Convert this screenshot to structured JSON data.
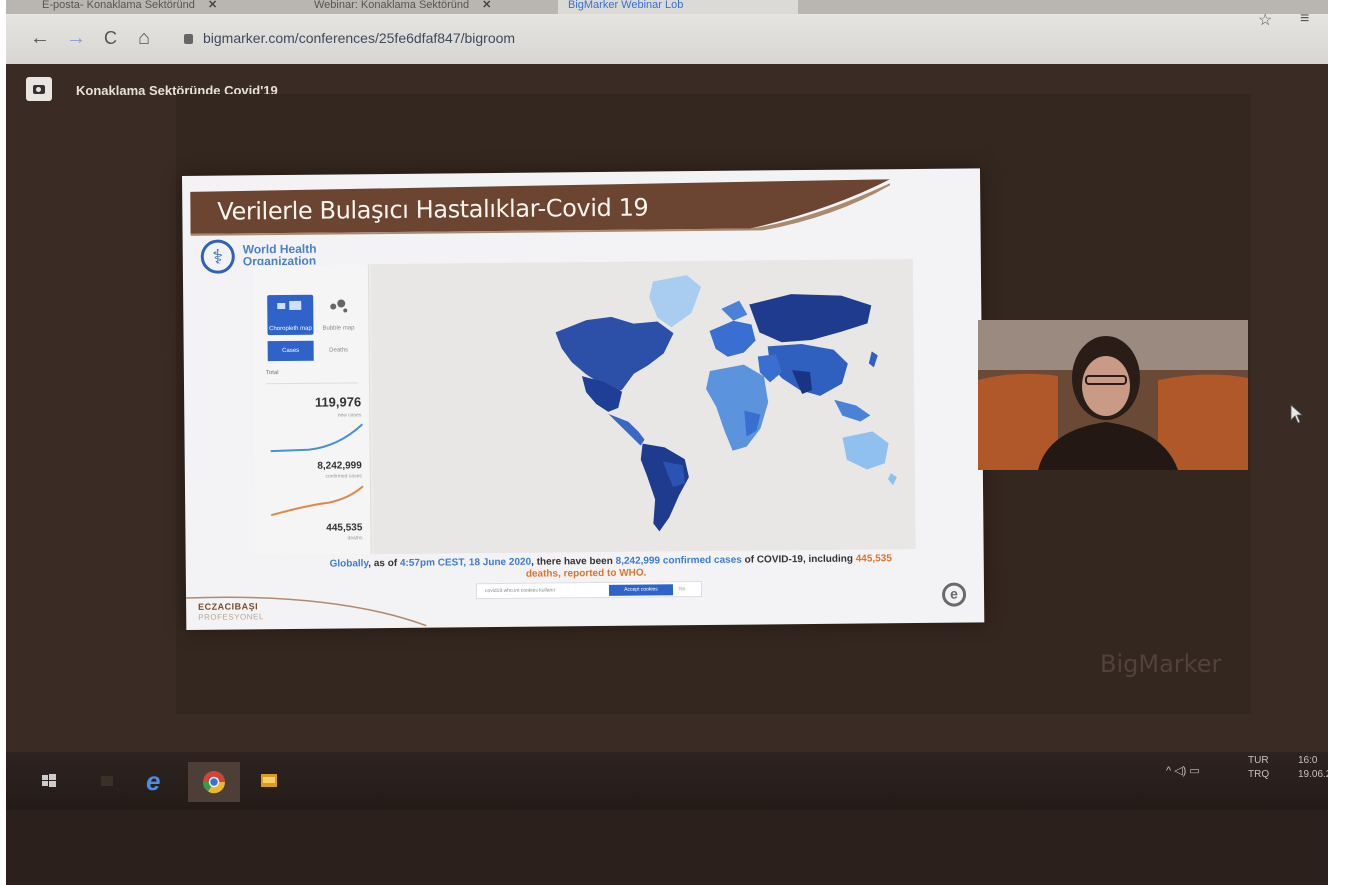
{
  "browser": {
    "tabs": [
      {
        "label": "E-posta- Konaklama Sektöründ",
        "close": "✕",
        "active": false
      },
      {
        "label": "Webinar: Konaklama Sektöründ",
        "close": "✕",
        "active": false
      },
      {
        "label": "BigMarker Webinar Lob",
        "close": "",
        "active": true
      }
    ],
    "url": "bigmarker.com/conferences/25fe6dfaf847/bigroom",
    "icons": {
      "back": "back-arrow-icon",
      "forward": "forward-arrow-icon",
      "reload": "reload-icon",
      "home": "home-icon",
      "star": "star-icon",
      "menu": "playlist-icon"
    }
  },
  "room": {
    "title": "Konaklama Sektöründe Covid'19",
    "watermark": "BigMarker"
  },
  "slide": {
    "title": "Verilerle Bulaşıcı Hastalıklar-Covid 19",
    "who_line1": "World Health",
    "who_line2": "Organization",
    "dashboard": {
      "tab_choropleth": "Choropleth map",
      "tab_bubble": "Bubble map",
      "btn_cases": "Cases",
      "btn_deaths": "Deaths",
      "select": "Total",
      "new_cases": "119,976",
      "new_cases_label": "new cases",
      "confirmed": "8,242,999",
      "confirmed_label": "confirmed cases",
      "deaths": "445,535",
      "deaths_label": "deaths"
    },
    "caption_prefix": "Globally",
    "caption_as_of": ", as of ",
    "caption_time": "4:57pm CEST, 18 June 2020",
    "caption_mid": ", there have been ",
    "caption_cases": "8,242,999",
    "caption_confirmed": " confirmed cases",
    "caption_tail": " of COVID-19, including ",
    "caption_deaths": "445,535",
    "caption_line2": "deaths, reported to WHO.",
    "cookie_text": "covid19.who.int cookies kullanır",
    "cookie_accept": "Accept cookies",
    "cookie_decline": "No",
    "brand": "ECZACIBAŞI",
    "brand_sub": "PROFESYONEL",
    "logo_letter": "e"
  },
  "taskbar": {
    "icons": [
      "windows-start-icon",
      "file-explorer-icon",
      "internet-explorer-icon",
      "chrome-icon",
      "presentation-icon"
    ],
    "tray_icons": "^ ◁) ▭",
    "lang1": "TUR",
    "lang2": "TRQ",
    "time": "16:0",
    "date": "19.06.2"
  },
  "colors": {
    "accent": "#2f63c9",
    "brown": "#6b4532",
    "who_blue": "#2f63b6"
  }
}
